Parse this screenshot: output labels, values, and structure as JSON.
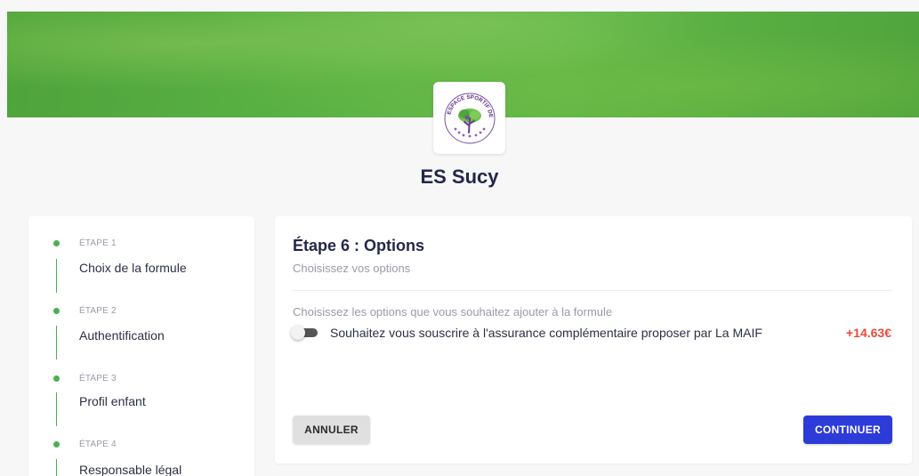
{
  "club": {
    "name": "ES Sucy",
    "logo_text": "ESPACE SPORTIF DE SUCY"
  },
  "colors": {
    "banner_green": "#5cb445",
    "step_done": "#4caf50",
    "primary": "#2d3bd8",
    "price": "#e74c3c"
  },
  "steps": [
    {
      "kicker": "ÉTAPE 1",
      "title": "Choix de la formule",
      "status": "done"
    },
    {
      "kicker": "ÉTAPE 2",
      "title": "Authentification",
      "status": "done"
    },
    {
      "kicker": "ÉTAPE 3",
      "title": "Profil enfant",
      "status": "done"
    },
    {
      "kicker": "ÉTAPE 4",
      "title": "Responsable légal",
      "status": "done"
    }
  ],
  "main": {
    "title": "Étape 6 : Options",
    "subtitle": "Choisissez vos options",
    "hint": "Choisissez les options que vous souhaitez ajouter à la formule",
    "option": {
      "label": "Souhaitez vous souscrire à l'assurance complémentaire proposer par La MAIF",
      "price": "+14.63€",
      "enabled": false
    },
    "cancel_label": "ANNULER",
    "continue_label": "CONTINUER"
  }
}
